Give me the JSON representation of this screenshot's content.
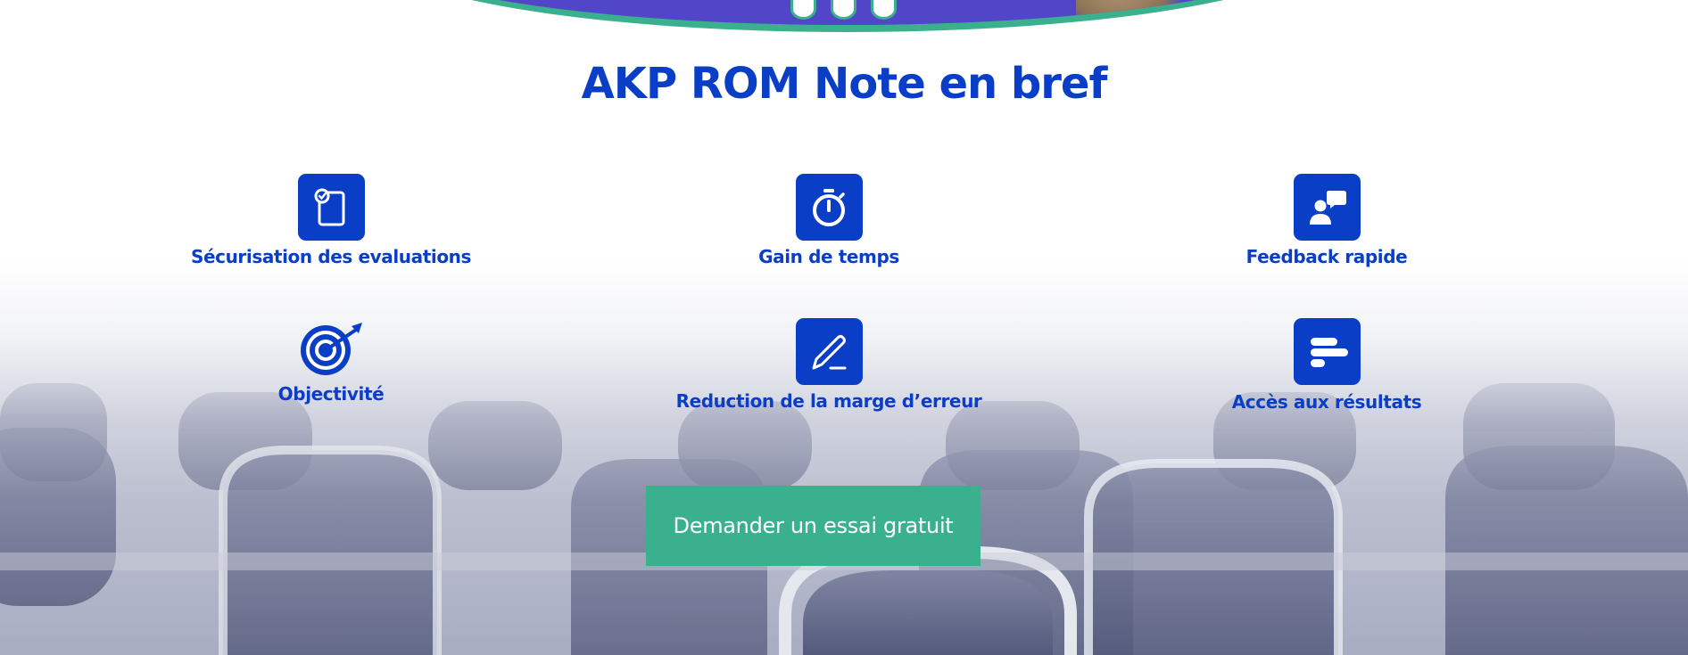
{
  "slider": {
    "dots": 3
  },
  "section": {
    "title": "AKP ROM Note en bref"
  },
  "features": [
    {
      "label": "Sécurisation des evaluations",
      "icon": "tablet-check-icon"
    },
    {
      "label": "Gain de temps",
      "icon": "stopwatch-icon"
    },
    {
      "label": "Feedback rapide",
      "icon": "user-chat-icon"
    },
    {
      "label": "Objectivité",
      "icon": "target-icon"
    },
    {
      "label": "Reduction de la marge d’erreur",
      "icon": "pen-icon"
    },
    {
      "label": "Accès aux résultats",
      "icon": "bar-list-icon"
    }
  ],
  "cta": {
    "label": "Demander un essai gratuit"
  },
  "colors": {
    "brand_blue": "#0b3ec6",
    "accent_green": "#3bb08f",
    "banner_purple": "#5145c8"
  }
}
